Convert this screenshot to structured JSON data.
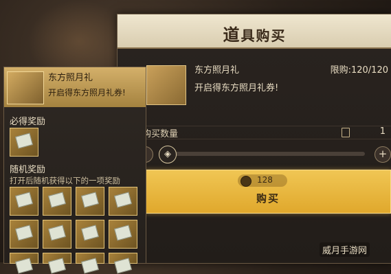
{
  "shop": {
    "title_first": "道",
    "title_rest": "具购买",
    "item": {
      "name": "东方照月礼",
      "limit": "限购:120/120",
      "desc": "开启得东方照月礼券!"
    },
    "quantity": {
      "label": "购买数量",
      "value": "1"
    },
    "slider": {
      "minus": "-",
      "plus": "+",
      "thumb_icon": "◈"
    },
    "buy": {
      "price": "128",
      "label": "购买"
    }
  },
  "reward_panel": {
    "name": "东方照月礼",
    "desc": "开启得东方照月礼券!",
    "guaranteed_label": "必得奖励",
    "random_label": "随机奖励",
    "random_desc": "打开后随机获得以下的一项奖励"
  },
  "watermark": "威月手游网",
  "colors": {
    "accent_gold": "#e0a82c",
    "title_bar": "#efe6cf",
    "panel_bg": "#2a2420"
  }
}
